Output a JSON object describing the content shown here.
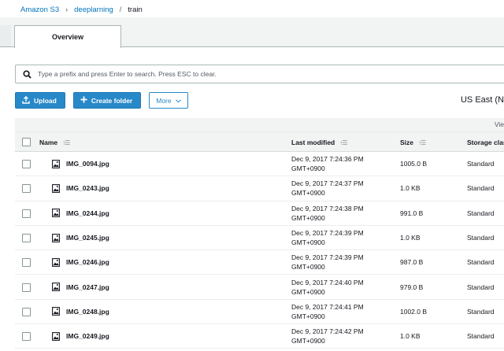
{
  "breadcrumb": {
    "items": [
      "Amazon S3",
      "deeplarning"
    ],
    "current": "train",
    "separator": "›"
  },
  "tabs": [
    {
      "label": "Overview"
    }
  ],
  "search": {
    "placeholder": "Type a prefix and press Enter to search. Press ESC to clear.",
    "value": ""
  },
  "toolbar": {
    "upload_label": "Upload",
    "create_folder_label": "Create folder",
    "more_label": "More"
  },
  "region": "US East (N",
  "viewbar": {
    "label": "Vie"
  },
  "table": {
    "columns": [
      "Name",
      "Last modified",
      "Size",
      "Storage clas"
    ],
    "rows": [
      {
        "name": "IMG_0094.jpg",
        "modified_date": "Dec 9, 2017 7:24:36 PM",
        "modified_tz": "GMT+0900",
        "size": "1005.0 B",
        "storage_class": "Standard"
      },
      {
        "name": "IMG_0243.jpg",
        "modified_date": "Dec 9, 2017 7:24:37 PM",
        "modified_tz": "GMT+0900",
        "size": "1.0 KB",
        "storage_class": "Standard"
      },
      {
        "name": "IMG_0244.jpg",
        "modified_date": "Dec 9, 2017 7:24:38 PM",
        "modified_tz": "GMT+0900",
        "size": "991.0 B",
        "storage_class": "Standard"
      },
      {
        "name": "IMG_0245.jpg",
        "modified_date": "Dec 9, 2017 7:24:39 PM",
        "modified_tz": "GMT+0900",
        "size": "1.0 KB",
        "storage_class": "Standard"
      },
      {
        "name": "IMG_0246.jpg",
        "modified_date": "Dec 9, 2017 7:24:39 PM",
        "modified_tz": "GMT+0900",
        "size": "987.0 B",
        "storage_class": "Standard"
      },
      {
        "name": "IMG_0247.jpg",
        "modified_date": "Dec 9, 2017 7:24:40 PM",
        "modified_tz": "GMT+0900",
        "size": "979.0 B",
        "storage_class": "Standard"
      },
      {
        "name": "IMG_0248.jpg",
        "modified_date": "Dec 9, 2017 7:24:41 PM",
        "modified_tz": "GMT+0900",
        "size": "1002.0 B",
        "storage_class": "Standard"
      },
      {
        "name": "IMG_0249.jpg",
        "modified_date": "Dec 9, 2017 7:24:42 PM",
        "modified_tz": "GMT+0900",
        "size": "1.0 KB",
        "storage_class": "Standard"
      }
    ]
  },
  "icons": {
    "search": "search-icon",
    "upload": "upload-icon",
    "create_folder": "plus-icon",
    "more": "chevron-down-icon",
    "sort": "sort-icon",
    "file": "image-file-icon"
  },
  "colors": {
    "primary": "#2889c9",
    "link": "#0073bb",
    "header_bg": "#f2f3f3",
    "text": "#16191f"
  }
}
